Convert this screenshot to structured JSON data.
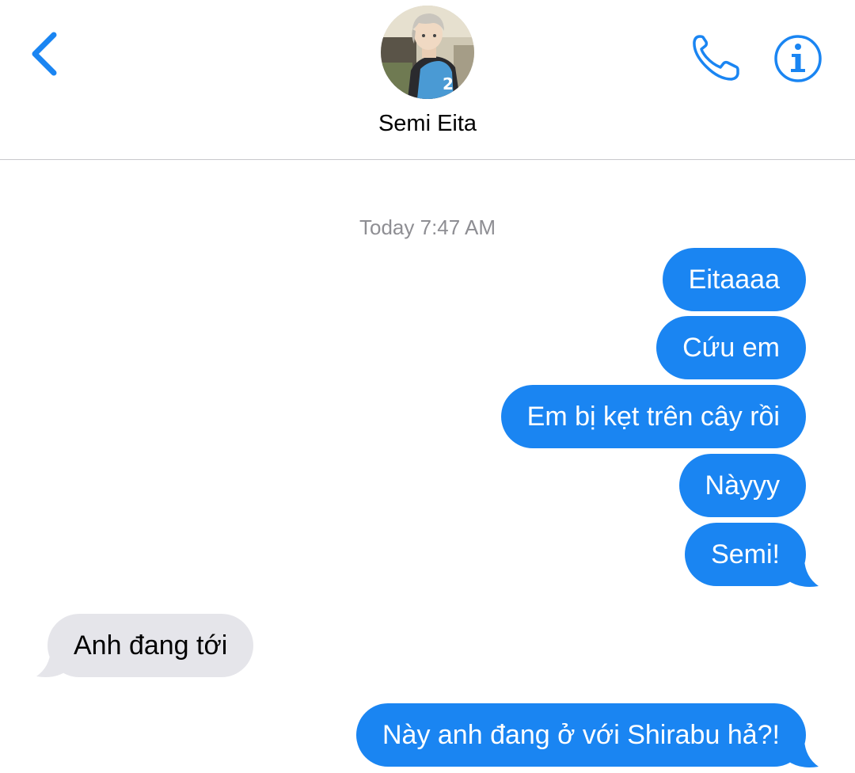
{
  "header": {
    "back_icon": "chevron-left-icon",
    "contact_name": "Semi Eita",
    "phone_icon": "phone-icon",
    "info_icon": "info-icon",
    "accent_color": "#1a85f2"
  },
  "conversation": {
    "timestamp": "Today 7:47 AM",
    "outgoing_color": "#1a85f2",
    "incoming_color": "#e5e5ea",
    "messages": [
      {
        "direction": "outgoing",
        "text": "Eitaaaa"
      },
      {
        "direction": "outgoing",
        "text": "Cứu em"
      },
      {
        "direction": "outgoing",
        "text": "Em bị kẹt trên cây rồi"
      },
      {
        "direction": "outgoing",
        "text": "Nàyyy"
      },
      {
        "direction": "outgoing",
        "text": "Semi!"
      },
      {
        "direction": "incoming",
        "text": "Anh đang tới"
      },
      {
        "direction": "outgoing",
        "text": "Này anh đang ở với Shirabu hả?!"
      }
    ]
  }
}
